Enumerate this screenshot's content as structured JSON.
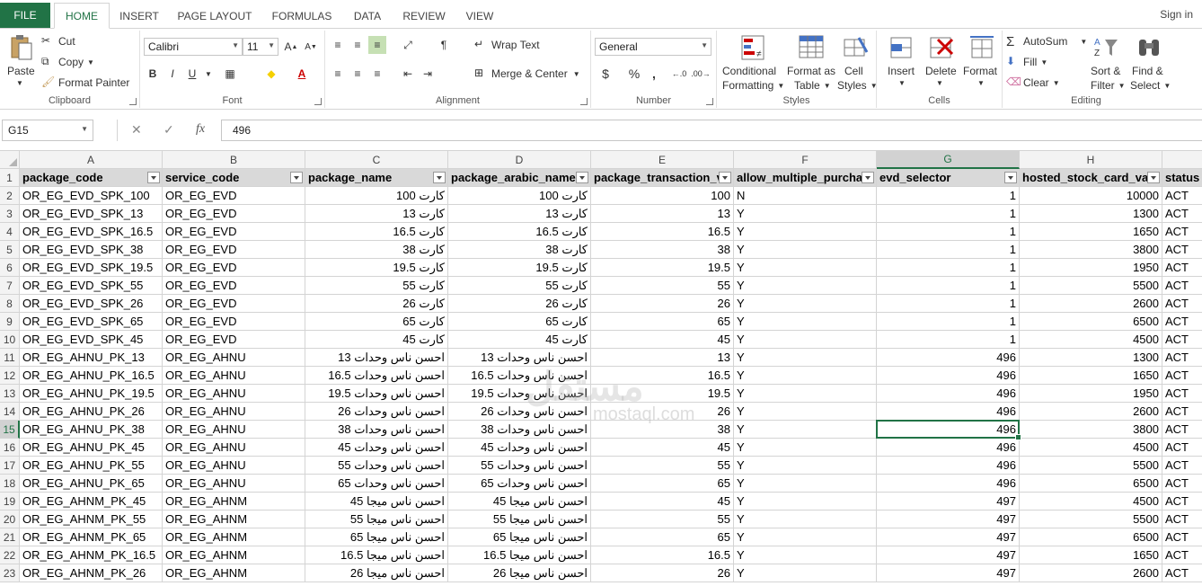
{
  "tabs": {
    "file": "FILE",
    "items": [
      "HOME",
      "INSERT",
      "PAGE LAYOUT",
      "FORMULAS",
      "DATA",
      "REVIEW",
      "VIEW"
    ],
    "signin": "Sign in"
  },
  "ribbon": {
    "clipboard": {
      "label": "Clipboard",
      "paste": "Paste",
      "cut": "Cut",
      "copy": "Copy",
      "format_painter": "Format Painter"
    },
    "font": {
      "label": "Font",
      "name": "Calibri",
      "size": "11",
      "bold": "B",
      "italic": "I",
      "underline": "U"
    },
    "alignment": {
      "label": "Alignment",
      "wrap_text": "Wrap Text",
      "merge_center": "Merge & Center"
    },
    "number": {
      "label": "Number",
      "format": "General",
      "currency": "$",
      "percent": "%",
      "comma": ","
    },
    "styles": {
      "label": "Styles",
      "conditional": "Conditional",
      "conditional2": "Formatting",
      "format_as": "Format as",
      "format_as2": "Table",
      "cell": "Cell",
      "cell2": "Styles"
    },
    "cells": {
      "label": "Cells",
      "insert": "Insert",
      "delete": "Delete",
      "format": "Format"
    },
    "editing": {
      "label": "Editing",
      "autosum": "AutoSum",
      "fill": "Fill",
      "clear": "Clear",
      "sort": "Sort &",
      "sort2": "Filter",
      "find": "Find &",
      "find2": "Select"
    }
  },
  "formula_bar": {
    "name_box": "G15",
    "fx": "fx",
    "value": "496"
  },
  "columns": [
    "A",
    "B",
    "C",
    "D",
    "E",
    "F",
    "G",
    "H"
  ],
  "selected": {
    "col": "G",
    "row": 15
  },
  "headers": [
    "package_code",
    "service_code",
    "package_name",
    "package_arabic_name",
    "package_transaction_v",
    "allow_multiple_purcha",
    "evd_selector",
    "hosted_stock_card_val",
    "status"
  ],
  "rows": [
    [
      "OR_EG_EVD_SPK_100",
      "OR_EG_EVD",
      "كارت 100",
      "كارت 100",
      "100",
      "N",
      "1",
      "10000",
      "ACT"
    ],
    [
      "OR_EG_EVD_SPK_13",
      "OR_EG_EVD",
      "كارت 13",
      "كارت 13",
      "13",
      "Y",
      "1",
      "1300",
      "ACT"
    ],
    [
      "OR_EG_EVD_SPK_16.5",
      "OR_EG_EVD",
      "كارت 16.5",
      "كارت 16.5",
      "16.5",
      "Y",
      "1",
      "1650",
      "ACT"
    ],
    [
      "OR_EG_EVD_SPK_38",
      "OR_EG_EVD",
      "كارت 38",
      "كارت 38",
      "38",
      "Y",
      "1",
      "3800",
      "ACT"
    ],
    [
      "OR_EG_EVD_SPK_19.5",
      "OR_EG_EVD",
      "كارت 19.5",
      "كارت 19.5",
      "19.5",
      "Y",
      "1",
      "1950",
      "ACT"
    ],
    [
      "OR_EG_EVD_SPK_55",
      "OR_EG_EVD",
      "كارت 55",
      "كارت 55",
      "55",
      "Y",
      "1",
      "5500",
      "ACT"
    ],
    [
      "OR_EG_EVD_SPK_26",
      "OR_EG_EVD",
      "كارت 26",
      "كارت 26",
      "26",
      "Y",
      "1",
      "2600",
      "ACT"
    ],
    [
      "OR_EG_EVD_SPK_65",
      "OR_EG_EVD",
      "كارت 65",
      "كارت 65",
      "65",
      "Y",
      "1",
      "6500",
      "ACT"
    ],
    [
      "OR_EG_EVD_SPK_45",
      "OR_EG_EVD",
      "كارت 45",
      "كارت 45",
      "45",
      "Y",
      "1",
      "4500",
      "ACT"
    ],
    [
      "OR_EG_AHNU_PK_13",
      "OR_EG_AHNU",
      "احسن ناس وحدات 13",
      "احسن ناس وحدات 13",
      "13",
      "Y",
      "496",
      "1300",
      "ACT"
    ],
    [
      "OR_EG_AHNU_PK_16.5",
      "OR_EG_AHNU",
      "احسن ناس وحدات 16.5",
      "احسن ناس وحدات 16.5",
      "16.5",
      "Y",
      "496",
      "1650",
      "ACT"
    ],
    [
      "OR_EG_AHNU_PK_19.5",
      "OR_EG_AHNU",
      "احسن ناس وحدات 19.5",
      "احسن ناس وحدات 19.5",
      "19.5",
      "Y",
      "496",
      "1950",
      "ACT"
    ],
    [
      "OR_EG_AHNU_PK_26",
      "OR_EG_AHNU",
      "احسن ناس وحدات 26",
      "احسن ناس وحدات 26",
      "26",
      "Y",
      "496",
      "2600",
      "ACT"
    ],
    [
      "OR_EG_AHNU_PK_38",
      "OR_EG_AHNU",
      "احسن ناس وحدات 38",
      "احسن ناس وحدات 38",
      "38",
      "Y",
      "496",
      "3800",
      "ACT"
    ],
    [
      "OR_EG_AHNU_PK_45",
      "OR_EG_AHNU",
      "احسن ناس وحدات 45",
      "احسن ناس وحدات 45",
      "45",
      "Y",
      "496",
      "4500",
      "ACT"
    ],
    [
      "OR_EG_AHNU_PK_55",
      "OR_EG_AHNU",
      "احسن ناس وحدات 55",
      "احسن ناس وحدات 55",
      "55",
      "Y",
      "496",
      "5500",
      "ACT"
    ],
    [
      "OR_EG_AHNU_PK_65",
      "OR_EG_AHNU",
      "احسن ناس وحدات 65",
      "احسن ناس وحدات 65",
      "65",
      "Y",
      "496",
      "6500",
      "ACT"
    ],
    [
      "OR_EG_AHNM_PK_45",
      "OR_EG_AHNM",
      "احسن ناس ميجا 45",
      "احسن ناس ميجا 45",
      "45",
      "Y",
      "497",
      "4500",
      "ACT"
    ],
    [
      "OR_EG_AHNM_PK_55",
      "OR_EG_AHNM",
      "احسن ناس ميجا 55",
      "احسن ناس ميجا 55",
      "55",
      "Y",
      "497",
      "5500",
      "ACT"
    ],
    [
      "OR_EG_AHNM_PK_65",
      "OR_EG_AHNM",
      "احسن ناس ميجا 65",
      "احسن ناس ميجا 65",
      "65",
      "Y",
      "497",
      "6500",
      "ACT"
    ],
    [
      "OR_EG_AHNM_PK_16.5",
      "OR_EG_AHNM",
      "احسن ناس ميجا 16.5",
      "احسن ناس ميجا 16.5",
      "16.5",
      "Y",
      "497",
      "1650",
      "ACT"
    ],
    [
      "OR_EG_AHNM_PK_26",
      "OR_EG_AHNM",
      "احسن ناس ميجا 26",
      "احسن ناس ميجا 26",
      "26",
      "Y",
      "497",
      "2600",
      "ACT"
    ]
  ],
  "watermark": {
    "logo": "مستقل",
    "site": "mostaql.com"
  },
  "colors": {
    "accent": "#217346",
    "header_fill": "#d9d9d9"
  }
}
